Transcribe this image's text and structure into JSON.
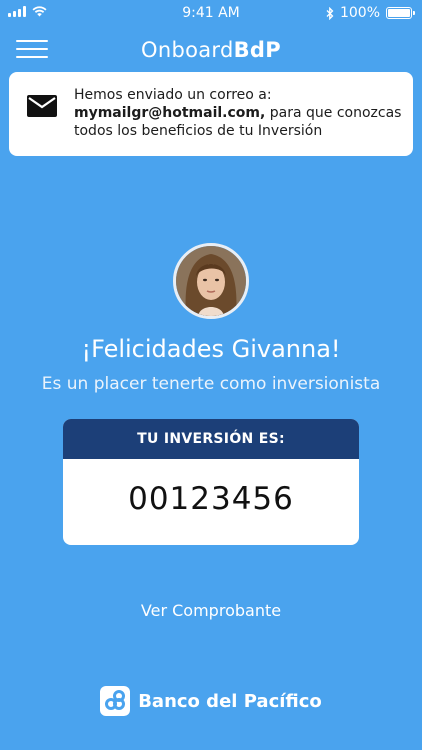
{
  "status_bar": {
    "time": "9:41 AM",
    "battery": "100%"
  },
  "header": {
    "title_prefix": "Onboard",
    "title_brand": "BdP"
  },
  "notice": {
    "line1": "Hemos enviado un correo a:",
    "email": "mymailgr@hotmail.com,",
    "line2_rest": " para que conozcas",
    "line3": "todos los beneficios de tu Inversión"
  },
  "greeting": {
    "title": "¡Felicidades Givanna!",
    "subtitle": "Es un placer tenerte como inversionista"
  },
  "investment": {
    "label": "TU INVERSIÓN ES:",
    "number": "00123456"
  },
  "actions": {
    "receipt_link": "Ver Comprobante"
  },
  "footer": {
    "bank_name": "Banco del Pacífico"
  },
  "colors": {
    "background": "#4aa3ee",
    "card_header": "#1c3f78"
  },
  "icons": [
    "menu-icon",
    "mail-icon",
    "wifi-icon",
    "bluetooth-icon",
    "battery-icon",
    "signal-icon"
  ]
}
